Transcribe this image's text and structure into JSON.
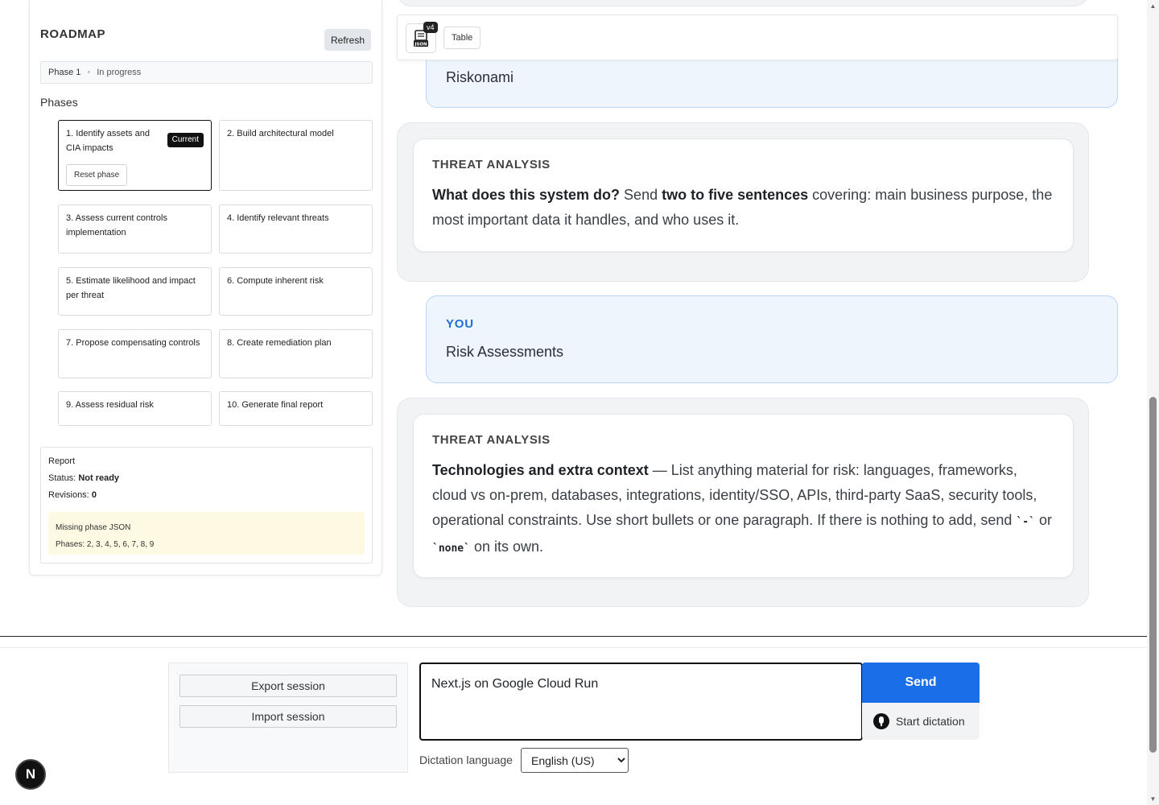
{
  "roadmap": {
    "title": "ROADMAP",
    "refresh_label": "Refresh",
    "phase_label": "Phase 1",
    "phase_state": "In progress",
    "phases_heading": "Phases",
    "current_badge": "Current",
    "reset_label": "Reset phase",
    "phases": [
      "1. Identify assets and CIA impacts",
      "2. Build architectural model",
      "3. Assess current controls implementation",
      "4. Identify relevant threats",
      "5. Estimate likelihood and impact per threat",
      "6. Compute inherent risk",
      "7. Propose compensating controls",
      "8. Create remediation plan",
      "9. Assess residual risk",
      "10. Generate final report"
    ],
    "report": {
      "title": "Report",
      "status_label": "Status:",
      "status_value": "Not ready",
      "revisions_label": "Revisions:",
      "revisions_value": "0",
      "missing_title": "Missing phase JSON",
      "missing_phases": "Phases: 2, 3, 4, 5, 6, 7, 8, 9"
    }
  },
  "toolbar": {
    "version_badge": "v4",
    "json_icon_text": "JSON",
    "table_label": "Table"
  },
  "chat": {
    "user_msg_1": "Riskonami",
    "ai_label_1": "THREAT ANALYSIS",
    "ai_1_bold_a": "What does this system do?",
    "ai_1_text_a": " Send ",
    "ai_1_bold_b": "two to five sentences",
    "ai_1_text_b": " covering: main business purpose, the most important data it handles, and who uses it.",
    "user_label_2": "YOU",
    "user_msg_2": "Risk Assessments",
    "ai_label_2": "THREAT ANALYSIS",
    "ai_2_bold": "Technologies and extra context",
    "ai_2_text_a": " — List anything material for risk: languages, frameworks, cloud vs on-prem, databases, integrations, identity/SSO, APIs, third-party SaaS, security tools, operational constraints. Use short bullets or one paragraph. If there is nothing to add, send ",
    "ai_2_code_a": "`-`",
    "ai_2_text_b": " or ",
    "ai_2_code_b": "`none`",
    "ai_2_text_c": " on its own."
  },
  "session": {
    "export_label": "Export session",
    "import_label": "Import session"
  },
  "composer": {
    "input_value": "Next.js on Google Cloud Run",
    "send_label": "Send",
    "dictation_label": "Start dictation",
    "language_label": "Dictation language",
    "language_value": "English (US)"
  },
  "dev_badge": "N",
  "colors": {
    "accent": "#1a6ee8",
    "user_bubble": "#eef5fd",
    "user_label": "#1f6fd6",
    "missing_bg": "#fdf9e3"
  }
}
